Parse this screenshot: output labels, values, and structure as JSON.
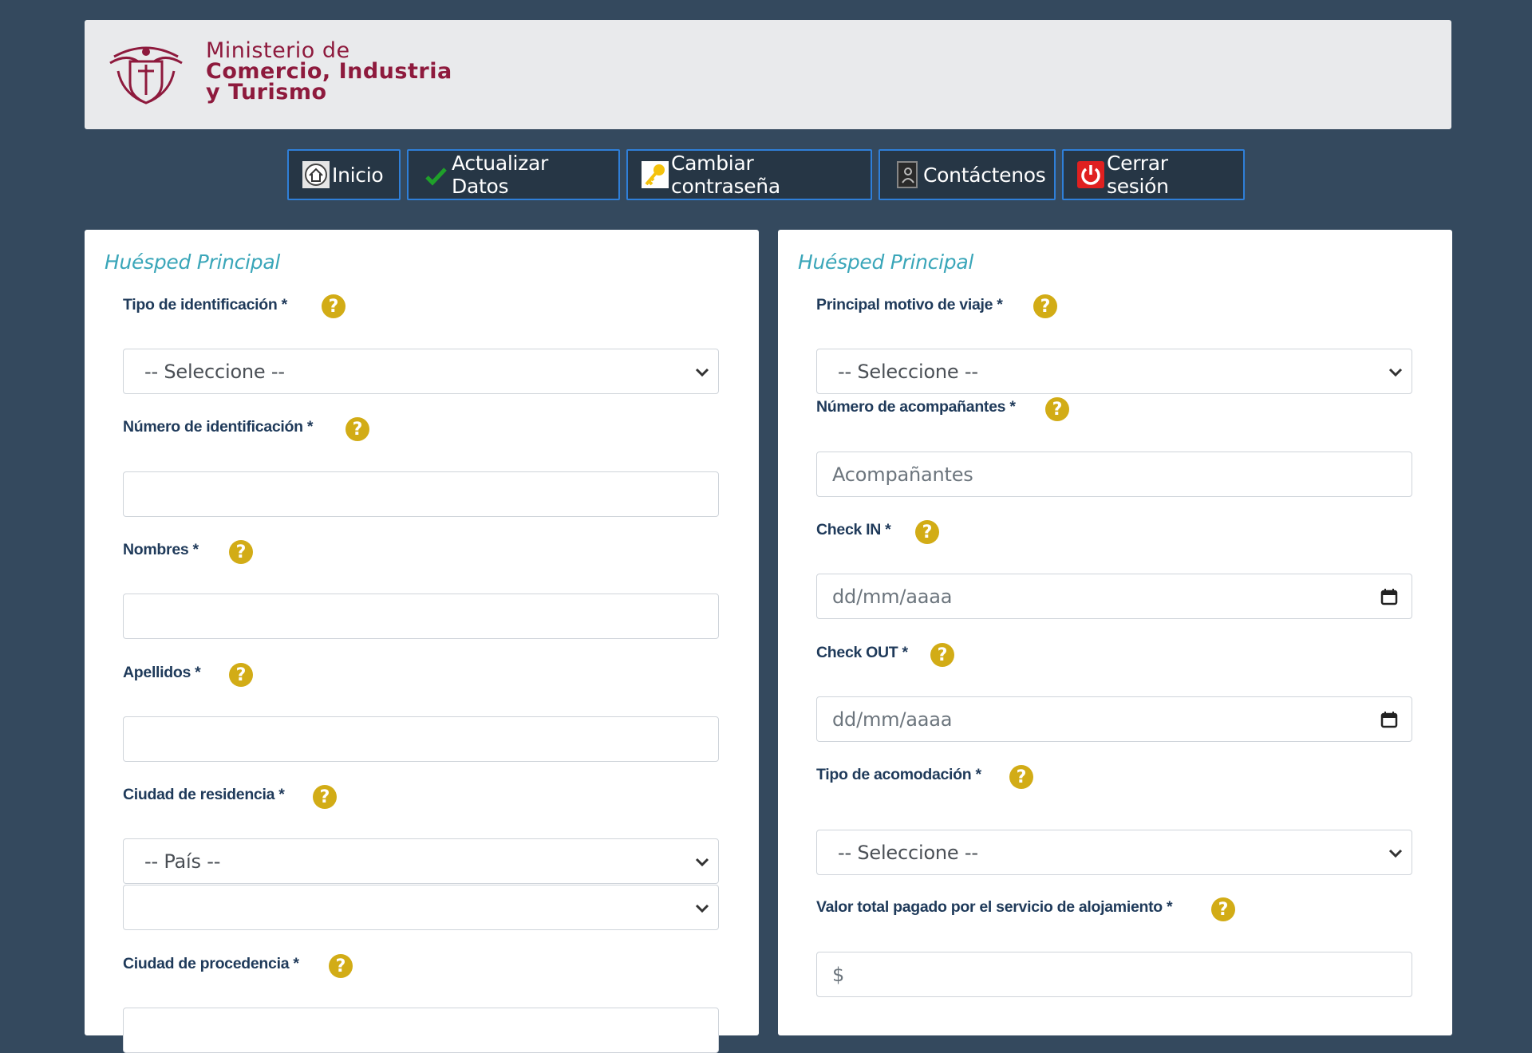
{
  "header": {
    "logo_line1": "Ministerio de",
    "logo_line2": "Comercio, Industria",
    "logo_line3": "y Turismo",
    "brand_color": "#8e1a3d"
  },
  "nav": {
    "items": [
      {
        "label": "Inicio",
        "icon": "home-icon"
      },
      {
        "label": "Actualizar Datos",
        "icon": "checkmark-icon"
      },
      {
        "label": "Cambiar contraseña",
        "icon": "key-icon"
      },
      {
        "label": "Contáctenos",
        "icon": "address-book-icon"
      },
      {
        "label": "Cerrar sesión",
        "icon": "power-icon"
      }
    ]
  },
  "left_panel": {
    "title": "Huésped Principal",
    "fields": [
      {
        "label": "Tipo de identificación *",
        "value": "-- Seleccione --"
      },
      {
        "label": "Número de identificación *",
        "value": ""
      },
      {
        "label": "Nombres *",
        "value": ""
      },
      {
        "label": "Apellidos *",
        "value": ""
      },
      {
        "label": "Ciudad de residencia *",
        "value": "-- País --",
        "value2": ""
      },
      {
        "label": "Ciudad de procedencia *",
        "value": ""
      }
    ]
  },
  "right_panel": {
    "title": "Huésped Principal",
    "fields": [
      {
        "label": "Principal motivo de viaje *",
        "value": "-- Seleccione --"
      },
      {
        "label": "Número de acompañantes *",
        "placeholder": "Acompañantes"
      },
      {
        "label": "Check IN *",
        "placeholder": "dd/mm/aaaa"
      },
      {
        "label": "Check OUT *",
        "placeholder": "dd/mm/aaaa"
      },
      {
        "label": "Tipo de acomodación *",
        "value": "-- Seleccione --"
      },
      {
        "label": "Valor total pagado por el servicio de alojamiento *",
        "placeholder": "$"
      }
    ]
  },
  "help_glyph": "?",
  "colors": {
    "background": "#34495e",
    "nav_border": "#2f7fd8",
    "title_teal": "#3aa6b9",
    "label_navy": "#1f3a5a",
    "help_gold": "#d2ac16"
  }
}
